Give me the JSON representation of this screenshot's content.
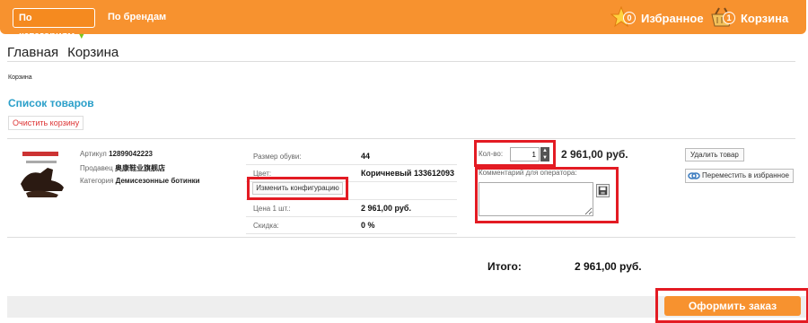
{
  "header": {
    "categories_label": "По категориям",
    "brands_label": "По брендам",
    "favorites_count": "0",
    "favorites_label": "Избранное",
    "cart_count": "1",
    "cart_label": "Корзина"
  },
  "breadcrumb": [
    "Главная",
    "Корзина"
  ],
  "small_crumb": "Корзина",
  "list_title": "Список товаров",
  "clear_cart_label": "Очистить корзину",
  "product": {
    "article_label": "Артикул",
    "article_value": "12899042223",
    "seller_label": "Продавец",
    "seller_value": "奥康鞋业旗舰店",
    "category_label": "Категория",
    "category_value": "Демисезонные ботинки",
    "params": [
      {
        "label": "Размер обуви:",
        "value": "44"
      },
      {
        "label": "Цвет:",
        "value": "Коричневый 133612093"
      },
      {
        "label": "",
        "value": ""
      },
      {
        "label": "Цена 1 шт.:",
        "value": "2 961,00 руб."
      },
      {
        "label": "Скидка:",
        "value": "0 %"
      }
    ],
    "change_config_label": "Изменить конфигурацию",
    "qty_label": "Кол-во:",
    "qty_value": "1",
    "line_total": "2 961,00 руб.",
    "comment_label": "Комментарий для оператора:",
    "delete_label": "Удалить товар",
    "move_fav_label": "Переместить в избранное"
  },
  "summary": {
    "total_label": "Итого:",
    "total_value": "2 961,00 руб."
  },
  "order_button_label": "Оформить заказ",
  "colors": {
    "brand_orange": "#f7922f",
    "link_blue": "#2a9fc9",
    "highlight_red": "#e31b23"
  }
}
